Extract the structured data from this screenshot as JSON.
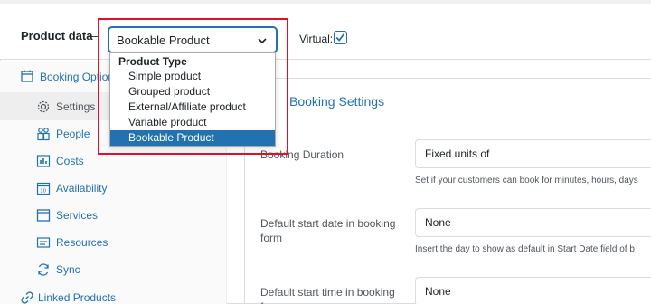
{
  "header": {
    "product_data_label": "Product data",
    "dash": "—",
    "product_type_value": "Bookable Product",
    "virtual_label": "Virtual:",
    "virtual_checked": true
  },
  "dropdown": {
    "group_label": "Product Type",
    "options": [
      "Simple product",
      "Grouped product",
      "External/Affiliate product",
      "Variable product",
      "Bookable Product"
    ],
    "selected": "Bookable Product"
  },
  "sidebar": {
    "items": [
      {
        "label": "Booking Options",
        "icon": "calendar-icon"
      },
      {
        "label": "Settings",
        "icon": "gear-icon"
      },
      {
        "label": "People",
        "icon": "people-icon"
      },
      {
        "label": "Costs",
        "icon": "chart-icon"
      },
      {
        "label": "Availability",
        "icon": "calendar-icon"
      },
      {
        "label": "Services",
        "icon": "window-icon"
      },
      {
        "label": "Resources",
        "icon": "list-icon"
      },
      {
        "label": "Sync",
        "icon": "sync-icon"
      },
      {
        "label": "Linked Products",
        "icon": "link-icon"
      }
    ]
  },
  "main": {
    "title": "Booking Settings",
    "fields": [
      {
        "label": "Booking Duration",
        "value": "Fixed units of",
        "help": "Set if your customers can book for minutes, hours, days"
      },
      {
        "label": "Default start date in booking form",
        "value": "None",
        "help": "Insert the day to show as default in Start Date field of b"
      },
      {
        "label": "Default start time in booking form",
        "value": "None",
        "help": ""
      }
    ]
  },
  "colors": {
    "accent": "#2271b1",
    "highlight": "#e0102a"
  }
}
